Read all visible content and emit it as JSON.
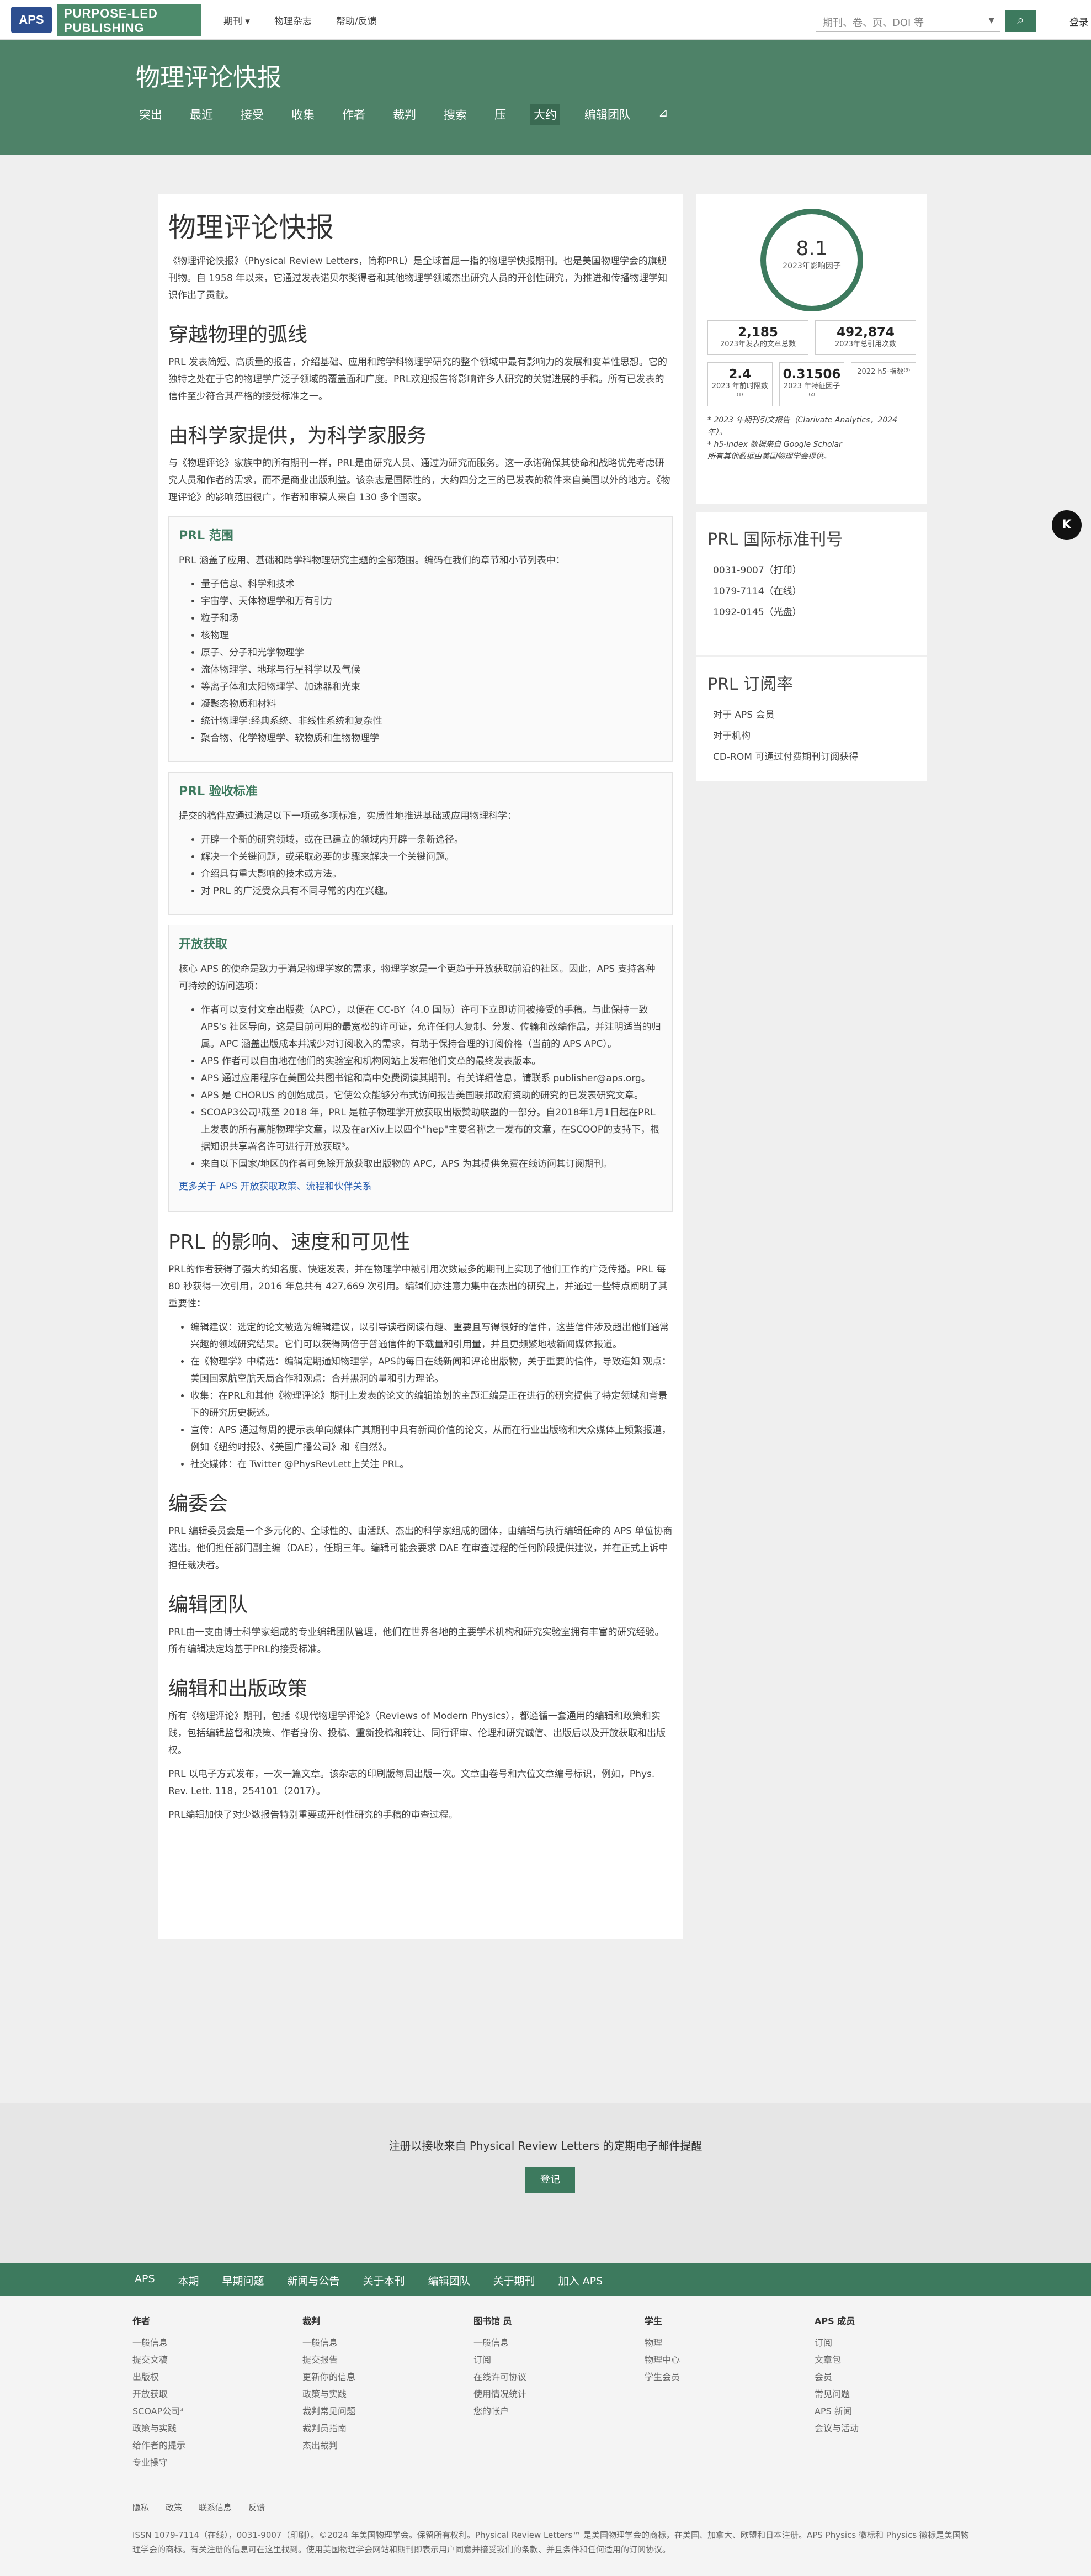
{
  "topbar": {
    "logo": "APS",
    "publisher": "PURPOSE-LED PUBLISHING",
    "nav": [
      "期刊 ▾",
      "物理杂志",
      "帮助/反馈"
    ],
    "search_placeholder": "期刊、卷、页、DOI 等",
    "login": "登录"
  },
  "hero": {
    "title": "物理评论快报",
    "nav": [
      "突出",
      "最近",
      "接受",
      "收集",
      "作者",
      "裁判",
      "搜索",
      "压",
      "大约",
      "编辑团队",
      "⊿"
    ]
  },
  "main": {
    "h1": "物理评论快报",
    "intro": "《物理评论快报》（Physical Review Letters，简称PRL）是全球首屈一指的物理学快报期刊。也是美国物理学会的旗舰刊物。自 1958 年以来，它通过发表诺贝尔奖得者和其他物理学领域杰出研究人员的开创性研究，为推进和传播物理学知识作出了贡献。",
    "h2a": "穿越物理的弧线",
    "p2": "PRL 发表简短、高质量的报告，介绍基础、应用和跨学科物理学研究的整个领域中最有影响力的发展和变革性思想。它的独特之处在于它的物理学广泛子领域的覆盖面和广度。PRL欢迎报告将影响许多人研究的关键进展的手稿。所有已发表的信件至少符合其严格的接受标准之一。",
    "h2b": "由科学家提供，为科学家服务",
    "p3": "与《物理评论》家族中的所有期刊一样，PRL是由研究人员、通过为研究而服务。这一承诺确保其使命和战略优先考虑研究人员和作者的需求，而不是商业出版利益。该杂志是国际性的，大约四分之三的已发表的稿件来自美国以外的地方。《物理评论》的影响范围很广，作者和审稿人来自 130 多个国家。",
    "scope": {
      "title": "PRL 范围",
      "intro": "PRL 涵盖了应用、基础和跨学科物理研究主题的全部范围。编码在我们的章节和小节列表中：",
      "items": [
        "量子信息、科学和技术",
        "宇宙学、天体物理学和万有引力",
        "粒子和场",
        "核物理",
        "原子、分子和光学物理学",
        "流体物理学、地球与行星科学以及气候",
        "等离子体和太阳物理学、加速器和光束",
        "凝聚态物质和材料",
        "统计物理学:经典系统、非线性系统和复杂性",
        "聚合物、化学物理学、软物质和生物物理学"
      ]
    },
    "accept": {
      "title": "PRL 验收标准",
      "intro": "提交的稿件应通过满足以下一项或多项标准，实质性地推进基础或应用物理科学：",
      "items": [
        "开辟一个新的研究领域，或在已建立的领域内开辟一条新途径。",
        "解决一个关键问题，或采取必要的步骤来解决一个关键问题。",
        "介绍具有重大影响的技术或方法。",
        "对 PRL 的广泛受众具有不同寻常的内在兴趣。"
      ]
    },
    "oa": {
      "title": "开放获取",
      "intro": "核心 APS 的使命是致力于满足物理学家的需求，物理学家是一个更趋于开放获取前沿的社区。因此，APS 支持各种可持续的访问选项：",
      "items": [
        "作者可以支付文章出版费（APC），以便在 CC-BY（4.0 国际）许可下立即访问被接受的手稿。与此保持一致 APS's 社区导向，这是目前可用的最宽松的许可证，允许任何人复制、分发、传输和改编作品，并注明适当的归属。APC 涵盖出版成本并减少对订阅收入的需求，有助于保持合理的订阅价格（当前的 APS APC）。",
        "APS 作者可以自由地在他们的实验室和机构网站上发布他们文章的最终发表版本。",
        "APS 通过应用程序在美国公共图书馆和高中免费阅读其期刊。有关详细信息，请联系 publisher@aps.org。",
        "APS 是 CHORUS 的创始成员，它使公众能够分布式访问报告美国联邦政府资助的研究的已发表研究文章。",
        "SCOAP3公司¹截至 2018 年，PRL 是粒子物理学开放获取出版赞助联盟的一部分。自2018年1月1日起在PRL上发表的所有高能物理学文章，以及在arXiv上以四个\"hep\"主要名称之一发布的文章，在SCOOP的支持下，根据知识共享署名许可进行开放获取³。",
        "来自以下国家/地区的作者可免除开放获取出版物的 APC，APS 为其提供免费在线访问其订阅期刊。"
      ],
      "more": "更多关于 APS 开放获取政策、流程和伙伴关系"
    },
    "h2c": "PRL 的影响、速度和可见性",
    "p4": "PRL的作者获得了强大的知名度、快速发表，并在物理学中被引用次数最多的期刊上实现了他们工作的广泛传播。PRL 每 80 秒获得一次引用，2016 年总共有 427,669 次引用。编辑们亦注意力集中在杰出的研究上，并通过一些特点阐明了其重要性：",
    "vis": [
      "编辑建议：选定的论文被选为编辑建议，以引导读者阅读有趣、重要且写得很好的信件，这些信件涉及超出他们通常兴趣的领域研究结果。它们可以获得两倍于普通信件的下载量和引用量，并且更频繁地被新闻媒体报道。",
      "在《物理学》中精选：编辑定期通知物理学，APS的每日在线新闻和评论出版物，关于重要的信件，导致造如 观点：美国国家航空航天局合作和观点：合并黑洞的量和引力理论。",
      "收集：在PRL和其他《物理评论》期刊上发表的论文的编辑策划的主题汇编是正在进行的研究提供了特定领域和背景下的研究历史概述。",
      "宣传：APS 通过每周的提示表单向媒体广其期刊中具有新闻价值的论文，从而在行业出版物和大众媒体上频繁报道，例如《纽约时报》、《美国广播公司》和《自然》。",
      "社交媒体：在 Twitter @PhysRevLett上关注 PRL。"
    ],
    "h2d": "编委会",
    "p5": "PRL 编辑委员会是一个多元化的、全球性的、由活跃、杰出的科学家组成的团体，由编辑与执行编辑任命的 APS 单位协商选出。他们担任部门副主编（DAE），任期三年。编辑可能会要求 DAE 在审查过程的任何阶段提供建议，并在正式上诉中担任裁决者。",
    "h2e": "编辑团队",
    "p6": "PRL由一支由博士科学家组成的专业编辑团队管理，他们在世界各地的主要学术机构和研究实验室拥有丰富的研究经验。所有编辑决定均基于PRL的接受标准。",
    "h2f": "编辑和出版政策",
    "p7": "所有《物理评论》期刊，包括《现代物理学评论》（Reviews of Modern Physics），都遵循一套通用的编辑和政策和实践，包括编辑监督和决策、作者身份、投稿、重新投稿和转让、同行评审、伦理和研究诚信、出版后以及开放获取和出版权。",
    "p8": "PRL 以电子方式发布，一次一篇文章。该杂志的印刷版每周出版一次。文章由卷号和六位文章编号标识，例如，Phys. Rev. Lett. 118，254101（2017）。",
    "p9": "PRL编辑加快了对少数报告特别重要或开创性研究的手稿的审查过程。"
  },
  "side": {
    "impact": "8.1",
    "impact_cap": "2023年影响因子",
    "stats": [
      {
        "n": "2,185",
        "t": "2023年发表的文章总数"
      },
      {
        "n": "492,874",
        "t": "2023年总引用次数"
      }
    ],
    "stats2": [
      {
        "n": "2.4",
        "t": "2023 年前时限数⁽¹⁾"
      },
      {
        "n": "0.31506",
        "t": "2023 年特征因子⁽²⁾"
      },
      {
        "n": "",
        "t": "2022 h5-指数⁽³⁾"
      }
    ],
    "note1": "* 2023 年期刊引文报告（Clarivate Analytics，2024 年）。",
    "note2": "* h5-index 数据来自 Google Scholar",
    "note3": "所有其他数据由美国物理学会提供。",
    "issn_title": "PRL 国际标准刊号",
    "issn": [
      "0031-9007（打印）",
      "1079-7114（在线）",
      "1092-0145（光盘）"
    ],
    "sub_title": "PRL 订阅率",
    "sub": [
      "对于 APS 会员",
      "对于机构",
      "CD-ROM 可通过付费期刊订阅获得"
    ]
  },
  "newsletter": {
    "text": "注册以接收来自 Physical Review Letters 的定期电子邮件提醒",
    "button": "登记"
  },
  "footerbar": [
    "APS",
    "本期",
    "早期问题",
    "新闻与公告",
    "关于本刊",
    "编辑团队",
    "关于期刊",
    "加入 APS"
  ],
  "footer": {
    "cols": [
      {
        "h": "作者",
        "items": [
          "一般信息",
          "提交文稿",
          "出版权",
          "开放获取",
          "SCOAP公司³",
          "政策与实践",
          "给作者的提示",
          "专业操守"
        ]
      },
      {
        "h": "裁判",
        "items": [
          "一般信息",
          "提交报告",
          "更新你的信息",
          "政策与实践",
          "裁判常见问题",
          "裁判员指南",
          "杰出裁判"
        ]
      },
      {
        "h": "图书馆 员",
        "items": [
          "一般信息",
          "订阅",
          "在线许可协议",
          "使用情况统计",
          "您的帐户"
        ]
      },
      {
        "h": "学生",
        "items": [
          "物理",
          "物理中心",
          "学生会员"
        ]
      },
      {
        "h": "APS 成员",
        "items": [
          "订阅",
          "文章包",
          "会员",
          "常见问题",
          "APS 新闻",
          "会议与活动"
        ]
      }
    ],
    "small": [
      "隐私",
      "政策",
      "联系信息",
      "反馈"
    ],
    "copy": "ISSN 1079-7114（在线），0031-9007（印刷）。©2024 年美国物理学会。保留所有权利。Physical Review Letters™ 是美国物理学会的商标，在美国、加拿大、欧盟和日本注册。APS Physics 徽标和 Physics 徽标是美国物理学会的商标。有关注册的信息可在这里找到。使用美国物理学会网站和期刊即表示用户同意并接受我们的条款、并且条件和任何适用的订阅协议。"
  }
}
